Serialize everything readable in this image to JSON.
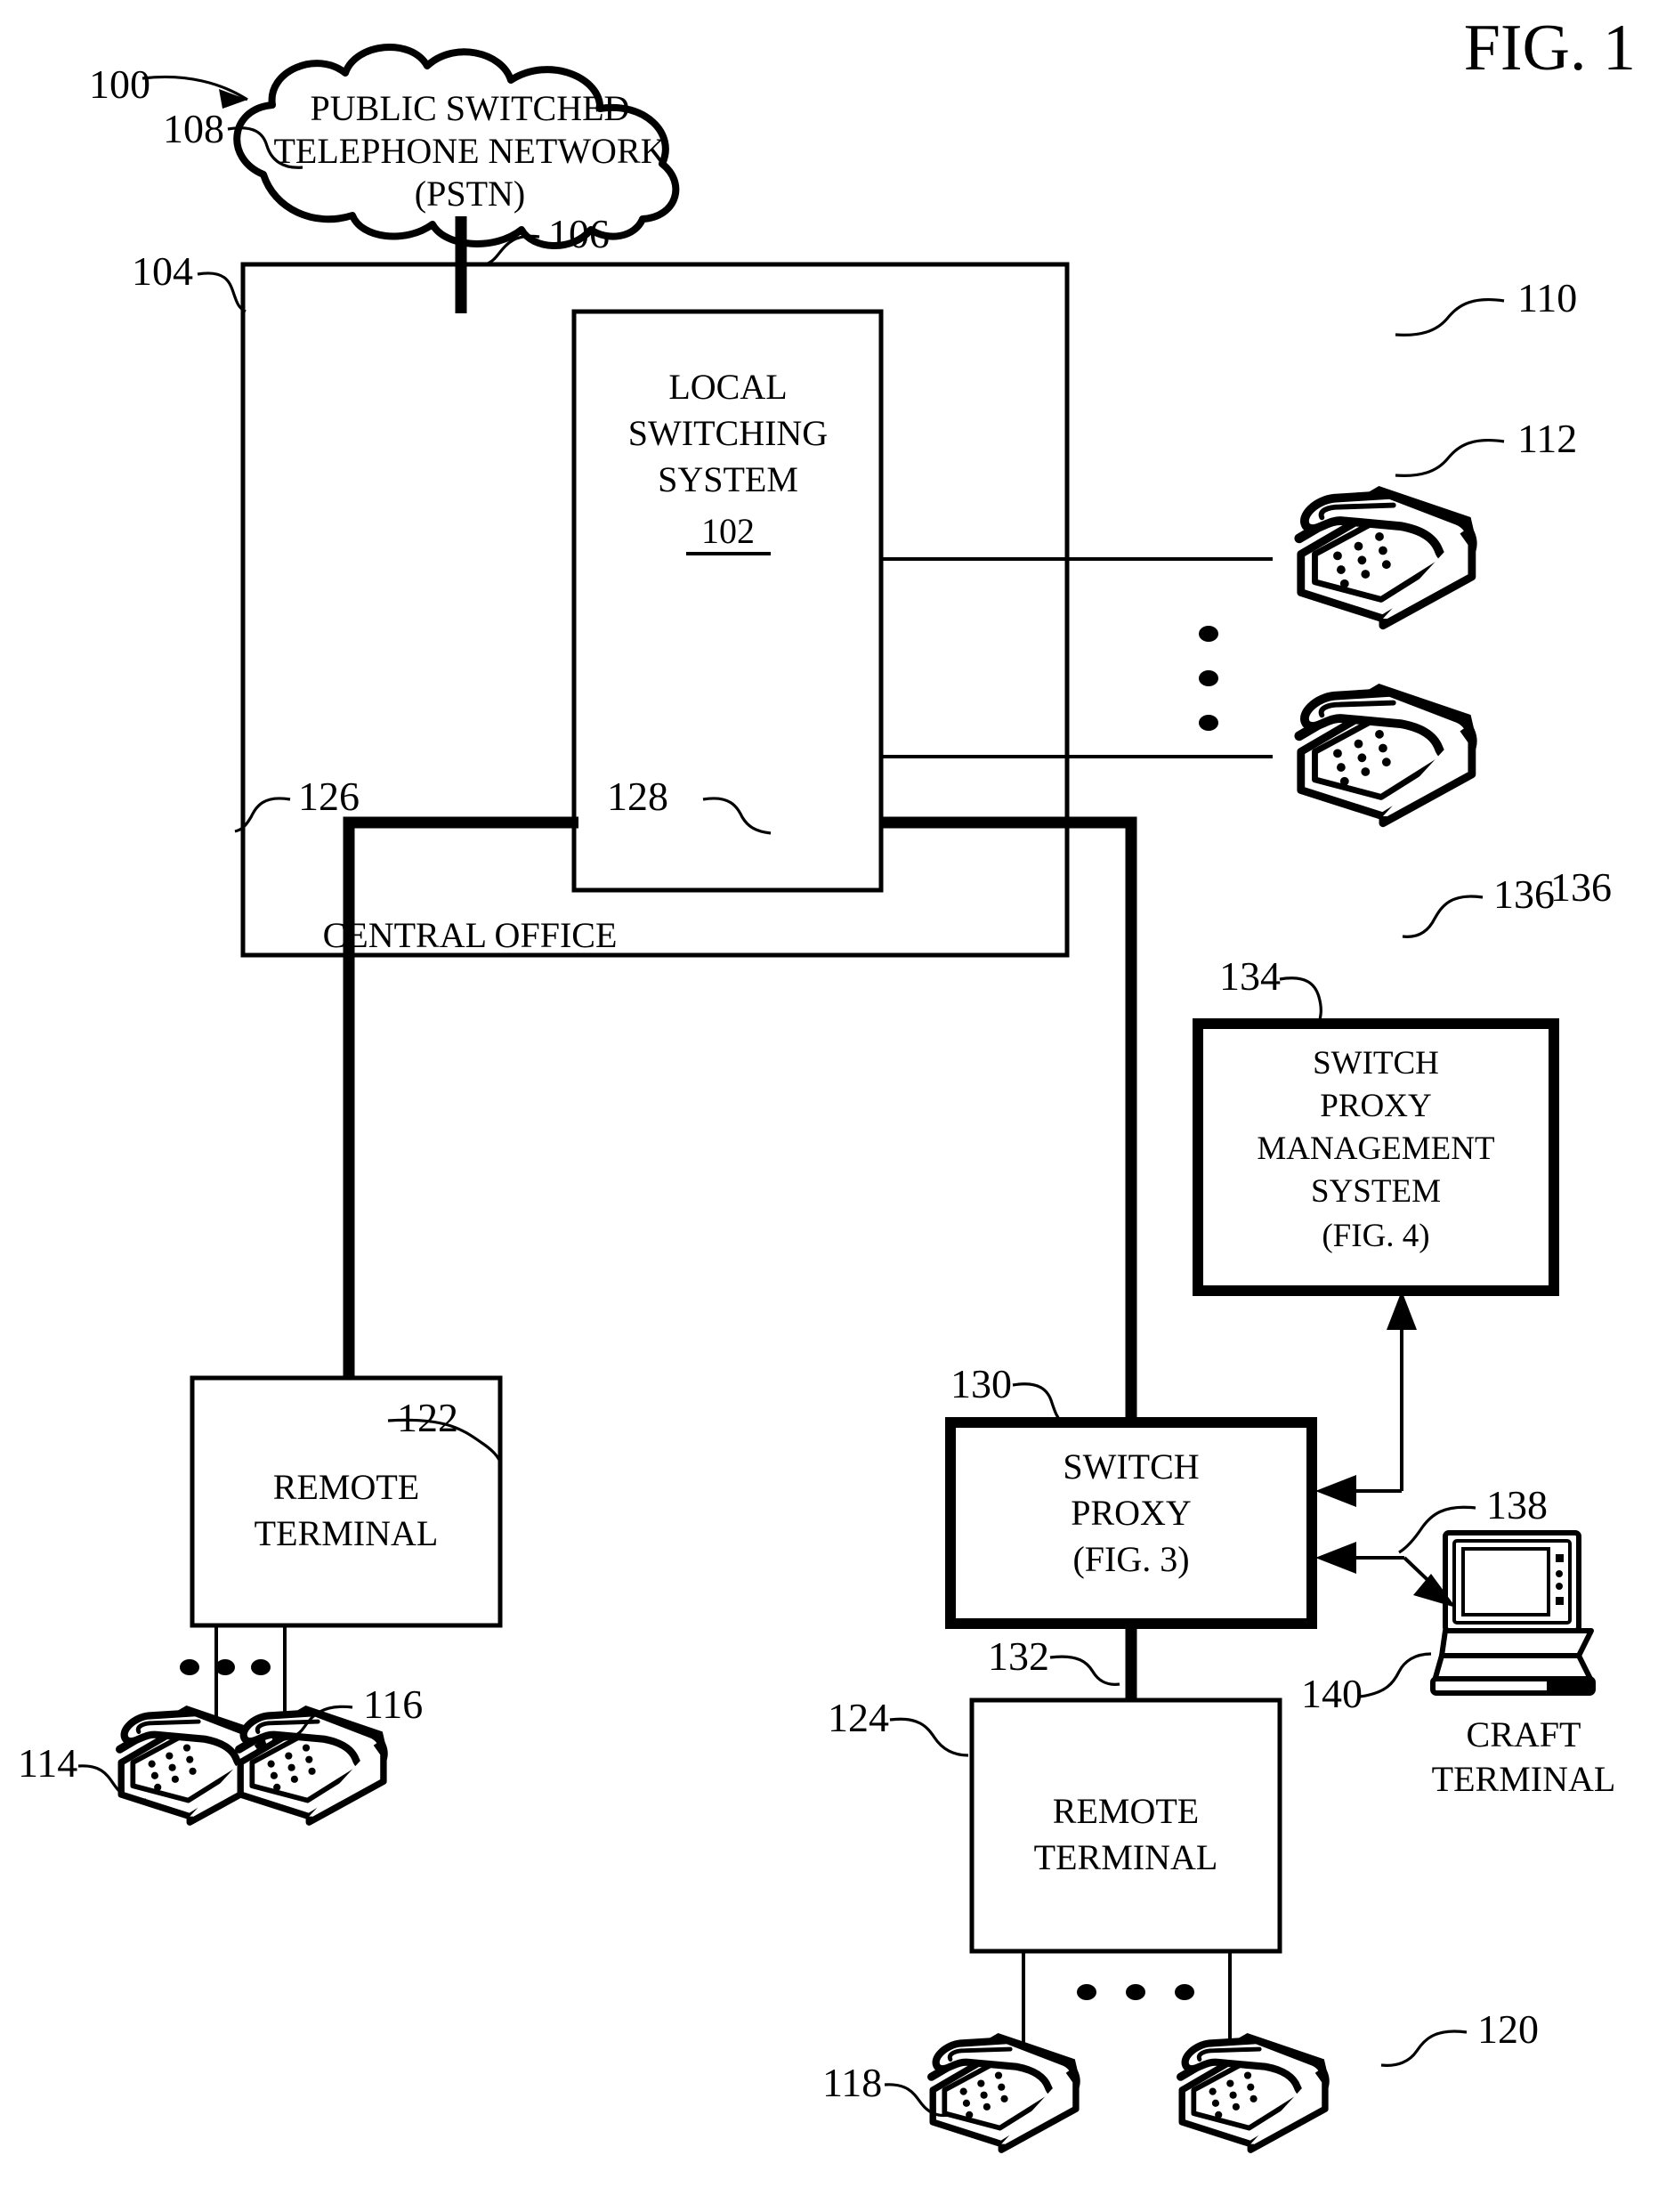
{
  "figure": {
    "label": "FIG. 1",
    "system_number": "100"
  },
  "nodes": {
    "pstn": {
      "ref": "108",
      "line1": "PUBLIC SWITCHED",
      "line2": "TELEPHONE NETWORK",
      "line3": "(PSTN)",
      "shape": "cloud-icon"
    },
    "central_office": {
      "ref": "104",
      "label": "CENTRAL OFFICE"
    },
    "local_switching_system": {
      "ref": "102",
      "line1": "LOCAL",
      "line2": "SWITCHING",
      "line3": "SYSTEM",
      "ref_inside": "102"
    },
    "switch_proxy_management_system": {
      "ref": "134",
      "line1": "SWITCH",
      "line2": "PROXY",
      "line3": "MANAGEMENT",
      "line4": "SYSTEM",
      "line5": "(FIG. 4)"
    },
    "switch_proxy": {
      "ref": "130",
      "line1": "SWITCH",
      "line2": "PROXY",
      "line3": "(FIG. 3)"
    },
    "remote_terminal_left": {
      "ref": "122",
      "line1": "REMOTE",
      "line2": "TERMINAL"
    },
    "remote_terminal_right": {
      "ref": "124",
      "line1": "REMOTE",
      "line2": "TERMINAL"
    },
    "craft_terminal": {
      "ref_device": "138",
      "ref_label": "140",
      "line1": "CRAFT",
      "line2": "TERMINAL"
    }
  },
  "telephones": [
    {
      "ref": "110",
      "name": "telephone-110"
    },
    {
      "ref": "112",
      "name": "telephone-112"
    },
    {
      "ref": "114",
      "name": "telephone-114"
    },
    {
      "ref": "116",
      "name": "telephone-116"
    },
    {
      "ref": "118",
      "name": "telephone-118"
    },
    {
      "ref": "120",
      "name": "telephone-120"
    }
  ],
  "connections": [
    {
      "ref": "106",
      "from": "pstn",
      "to": "local-switching-system"
    },
    {
      "ref": "126",
      "from": "central-office",
      "to": "remote-terminal-122"
    },
    {
      "ref": "128",
      "from": "central-office",
      "to": "switch-proxy"
    },
    {
      "ref": "132",
      "from": "switch-proxy",
      "to": "remote-terminal-124"
    },
    {
      "ref": "136",
      "from": "switch-proxy-management-system",
      "to": "switch-proxy"
    }
  ],
  "ellipsis": "• • •",
  "colors": {
    "ink": "#000000",
    "paper": "#ffffff"
  }
}
